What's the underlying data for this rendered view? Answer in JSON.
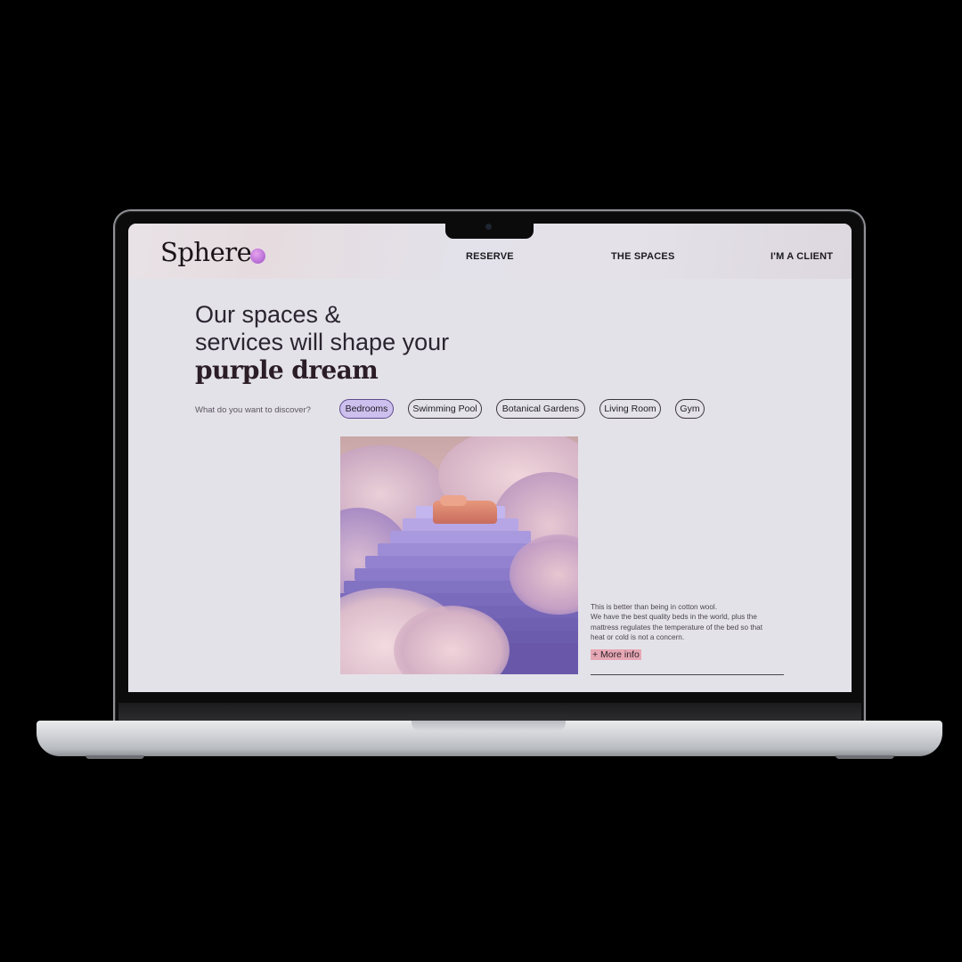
{
  "brand": {
    "name": "Sphere",
    "accent_color": "#b46ad4"
  },
  "nav": {
    "links": [
      {
        "label": "RESERVE"
      },
      {
        "label": "THE SPACES"
      },
      {
        "label": "I'M A CLIENT"
      }
    ]
  },
  "hero": {
    "line1": "Our spaces &",
    "line2": "services will shape your",
    "accent": "purple dream"
  },
  "discover": {
    "prompt": "What do you want to discover?",
    "selected": "Bedrooms",
    "options": [
      {
        "label": "Bedrooms"
      },
      {
        "label": "Swimming Pool"
      },
      {
        "label": "Botanical Gardens"
      },
      {
        "label": "Living Room"
      },
      {
        "label": "Gym"
      }
    ]
  },
  "feature": {
    "image_icon": "bed-in-clouds-image",
    "desc_line1": "This is better than being in cotton wool.",
    "desc_line2": "We have the best quality beds in the world, plus the mattress regulates the temperature of the bed so that heat or cold is not a concern.",
    "more_label": "+ More info"
  },
  "colors": {
    "page_background": "#000000",
    "screen_background": "#e4e2e9",
    "chip_active": "#cdc0ee",
    "more_highlight": "#e6a7b4"
  }
}
